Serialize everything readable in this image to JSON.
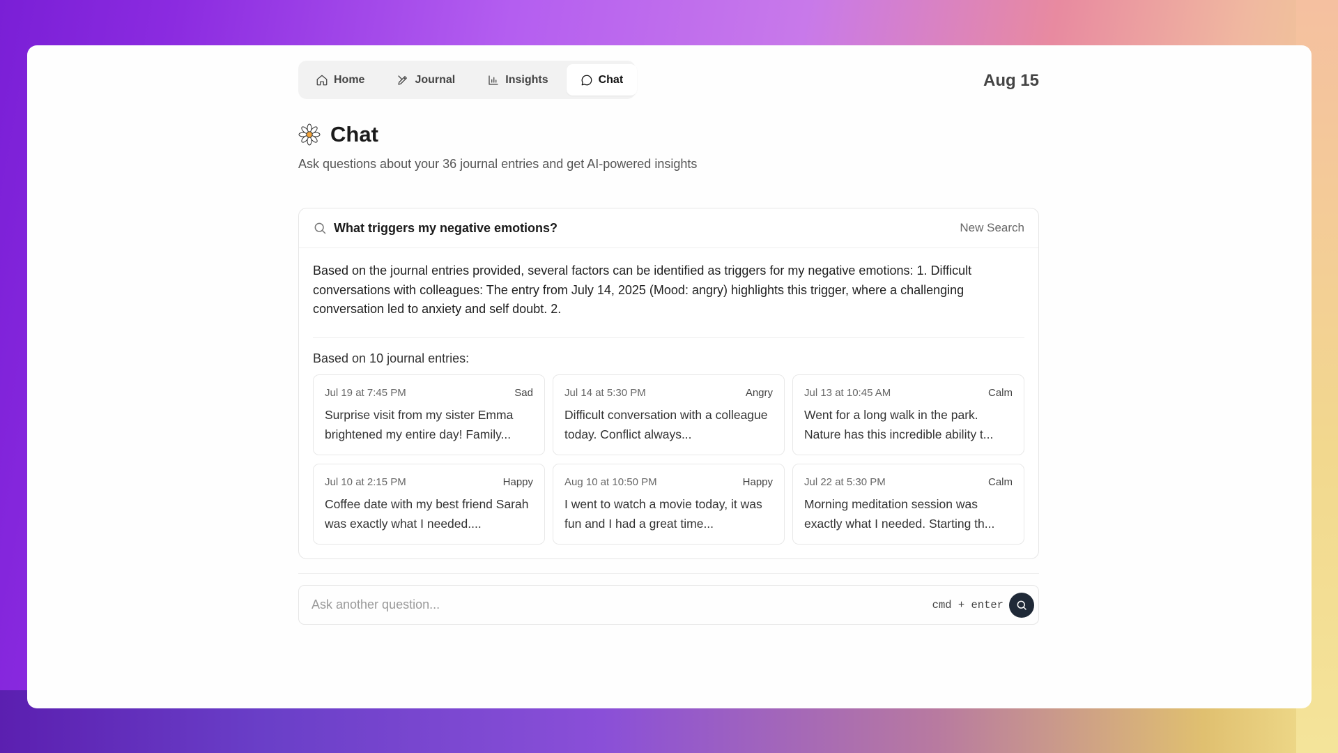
{
  "nav": {
    "tabs": [
      {
        "label": "Home",
        "icon": "home-icon"
      },
      {
        "label": "Journal",
        "icon": "pen-icon"
      },
      {
        "label": "Insights",
        "icon": "bar-chart-icon"
      },
      {
        "label": "Chat",
        "icon": "chat-bubble-icon",
        "active": true
      }
    ]
  },
  "header": {
    "date": "Aug 15"
  },
  "page": {
    "icon": "flower-icon",
    "title": "Chat",
    "subtitle": "Ask questions about your 36 journal entries and get AI-powered insights"
  },
  "result": {
    "query": "What triggers my negative emotions?",
    "new_search_label": "New Search",
    "answer": "Based on the journal entries provided, several factors can be identified as triggers for my negative emotions: 1. Difficult conversations with colleagues: The entry from July 14, 2025 (Mood: angry) highlights this trigger, where a challenging conversation led to anxiety and self doubt. 2.",
    "based_on": "Based on 10 journal entries:",
    "entries": [
      {
        "date": "Jul 19 at 7:45 PM",
        "mood": "Sad",
        "text": "Surprise visit from my sister Emma brightened my entire day! Family..."
      },
      {
        "date": "Jul 14 at 5:30 PM",
        "mood": "Angry",
        "text": "Difficult conversation with a colleague today. Conflict always..."
      },
      {
        "date": "Jul 13 at 10:45 AM",
        "mood": "Calm",
        "text": "Went for a long walk in the park. Nature has this incredible ability t..."
      },
      {
        "date": "Jul 10 at 2:15 PM",
        "mood": "Happy",
        "text": "Coffee date with my best friend Sarah was exactly what I needed...."
      },
      {
        "date": "Aug 10 at 10:50 PM",
        "mood": "Happy",
        "text": "I went to watch a movie today, it was fun and I had a great time..."
      },
      {
        "date": "Jul 22 at 5:30 PM",
        "mood": "Calm",
        "text": "Morning meditation session was exactly what I needed. Starting th..."
      }
    ]
  },
  "ask": {
    "placeholder": "Ask another question...",
    "shortcut": "cmd + enter",
    "submit_icon": "search-icon"
  }
}
